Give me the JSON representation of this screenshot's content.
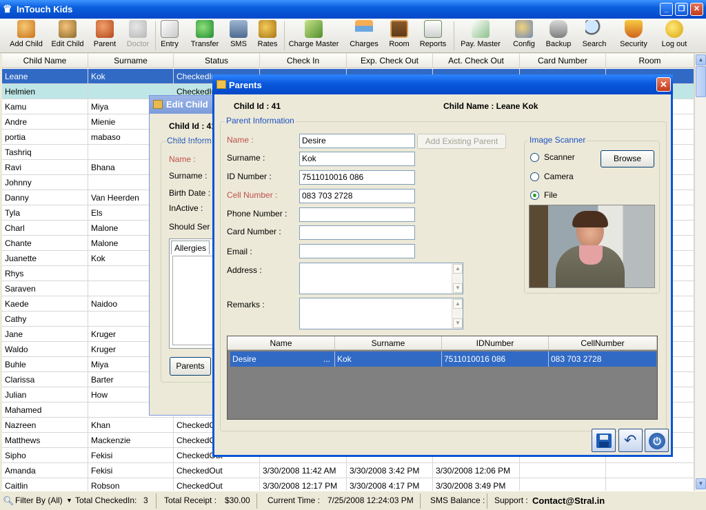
{
  "window": {
    "title": "InTouch Kids"
  },
  "toolbar": {
    "add_child": "Add Child",
    "edit_child": "Edit Child",
    "parent": "Parent",
    "doctor": "Doctor",
    "entry": "Entry",
    "transfer": "Transfer",
    "sms": "SMS",
    "rates": "Rates",
    "charge_master": "Charge Master",
    "charges": "Charges",
    "room": "Room",
    "reports": "Reports",
    "pay_master": "Pay. Master",
    "config": "Config",
    "backup": "Backup",
    "search": "Search",
    "security": "Security",
    "logout": "Log out"
  },
  "grid": {
    "headers": [
      "Child Name",
      "Surname",
      "Status",
      "Check In",
      "Exp. Check Out",
      "Act. Check Out",
      "Card Number",
      "Room"
    ],
    "rows": [
      {
        "name": "Leane",
        "surname": "Kok",
        "status": "CheckedIn",
        "checkin": "",
        "expout": "",
        "actout": ""
      },
      {
        "name": "Helmien",
        "surname": "",
        "status": "CheckedIn",
        "checkin": "",
        "expout": "",
        "actout": ""
      },
      {
        "name": "Kamu",
        "surname": "Miya",
        "status": "",
        "checkin": "",
        "expout": "",
        "actout": ""
      },
      {
        "name": "Andre",
        "surname": "Mienie",
        "status": "",
        "checkin": "",
        "expout": "",
        "actout": ""
      },
      {
        "name": "portia",
        "surname": "mabaso",
        "status": "",
        "checkin": "",
        "expout": "",
        "actout": ""
      },
      {
        "name": "Tashriq",
        "surname": "",
        "status": "",
        "checkin": "",
        "expout": "",
        "actout": ""
      },
      {
        "name": "Ravi",
        "surname": "Bhana",
        "status": "",
        "checkin": "",
        "expout": "",
        "actout": ""
      },
      {
        "name": "Johnny",
        "surname": "",
        "status": "",
        "checkin": "",
        "expout": "",
        "actout": ""
      },
      {
        "name": "Danny",
        "surname": "Van Heerden",
        "status": "",
        "checkin": "",
        "expout": "",
        "actout": ""
      },
      {
        "name": "Tyla",
        "surname": "Els",
        "status": "",
        "checkin": "",
        "expout": "",
        "actout": ""
      },
      {
        "name": "Charl",
        "surname": "Malone",
        "status": "",
        "checkin": "",
        "expout": "",
        "actout": ""
      },
      {
        "name": "Chante",
        "surname": "Malone",
        "status": "",
        "checkin": "",
        "expout": "",
        "actout": ""
      },
      {
        "name": "Juanette",
        "surname": "Kok",
        "status": "",
        "checkin": "",
        "expout": "",
        "actout": ""
      },
      {
        "name": "Rhys",
        "surname": "",
        "status": "",
        "checkin": "",
        "expout": "",
        "actout": ""
      },
      {
        "name": "Saraven",
        "surname": "",
        "status": "",
        "checkin": "",
        "expout": "",
        "actout": ""
      },
      {
        "name": "Kaede",
        "surname": "Naidoo",
        "status": "",
        "checkin": "",
        "expout": "",
        "actout": ""
      },
      {
        "name": "Cathy",
        "surname": "",
        "status": "",
        "checkin": "",
        "expout": "",
        "actout": ""
      },
      {
        "name": "Jane",
        "surname": "Kruger",
        "status": "",
        "checkin": "",
        "expout": "",
        "actout": ""
      },
      {
        "name": "Waldo",
        "surname": "Kruger",
        "status": "",
        "checkin": "",
        "expout": "",
        "actout": ""
      },
      {
        "name": "Buhle",
        "surname": "Miya",
        "status": "",
        "checkin": "",
        "expout": "",
        "actout": ""
      },
      {
        "name": "Clarissa",
        "surname": "Barter",
        "status": "",
        "checkin": "",
        "expout": "",
        "actout": ""
      },
      {
        "name": "Julian",
        "surname": "How",
        "status": "",
        "checkin": "",
        "expout": "",
        "actout": ""
      },
      {
        "name": "Mahamed",
        "surname": "",
        "status": "",
        "checkin": "",
        "expout": "",
        "actout": ""
      },
      {
        "name": "Nazreen",
        "surname": "Khan",
        "status": "CheckedOut",
        "checkin": "",
        "expout": "",
        "actout": ""
      },
      {
        "name": "Matthews",
        "surname": "Mackenzie",
        "status": "CheckedOut",
        "checkin": "",
        "expout": "",
        "actout": ""
      },
      {
        "name": "Sipho",
        "surname": "Fekisi",
        "status": "CheckedOut",
        "checkin": "",
        "expout": "",
        "actout": ""
      },
      {
        "name": "Amanda",
        "surname": "Fekisi",
        "status": "CheckedOut",
        "checkin": "3/30/2008 11:42 AM",
        "expout": "3/30/2008 3:42 PM",
        "actout": "3/30/2008 12:06 PM"
      },
      {
        "name": "Caitlin",
        "surname": "Robson",
        "status": "CheckedOut",
        "checkin": "3/30/2008 12:17 PM",
        "expout": "3/30/2008 4:17 PM",
        "actout": "3/30/2008 3:49 PM"
      }
    ]
  },
  "status": {
    "filter": "Filter By (All)",
    "total_checked_label": "Total CheckedIn:",
    "total_checked_value": "3",
    "receipt_label": "Total Receipt :",
    "receipt_value": "$30.00",
    "time_label": "Current Time :",
    "time_value": "7/25/2008 12:24:03 PM",
    "sms_label": "SMS Balance :",
    "support_label": "Support :",
    "support_value": "Contact@Stral.in"
  },
  "edit_child": {
    "title": "Edit Child",
    "child_id": "Child Id : 41",
    "section": "Child Inform",
    "name_label": "Name :",
    "surname_label": "Surname :",
    "birth_label": "Birth Date :",
    "inactive_label": "InActive :",
    "should_label": "Should Ser",
    "allergies_tab": "Allergies",
    "parents_button": "Parents"
  },
  "parents": {
    "title": "Parents",
    "child_id": "Child Id : 41",
    "child_name": "Child Name : Leane Kok",
    "section": "Parent Information",
    "name_label": "Name :",
    "name_value": "Desire",
    "surname_label": "Surname :",
    "surname_value": "Kok",
    "id_label": "ID Number :",
    "id_value": "7511010016 086",
    "cell_label": "Cell Number :",
    "cell_value": "083 703 2728",
    "phone_label": "Phone Number :",
    "phone_value": "",
    "card_label": "Card Number :",
    "card_value": "",
    "email_label": "Email :",
    "email_value": "",
    "address_label": "Address :",
    "remarks_label": "Remarks :",
    "add_existing": "Add Existing Parent",
    "scanner_section": "Image Scanner",
    "opt_scanner": "Scanner",
    "opt_camera": "Camera",
    "opt_file": "File",
    "browse": "Browse",
    "table_headers": [
      "Name",
      "Surname",
      "IDNumber",
      "CellNumber"
    ],
    "table_row": {
      "name": "Desire",
      "ellipsis": "...",
      "surname": "Kok",
      "id": "7511010016 086",
      "cell": "083 703 2728"
    }
  },
  "colors": {
    "accent": "#0a5fdd",
    "selection": "#316ac5",
    "required_label": "#c0504d"
  }
}
